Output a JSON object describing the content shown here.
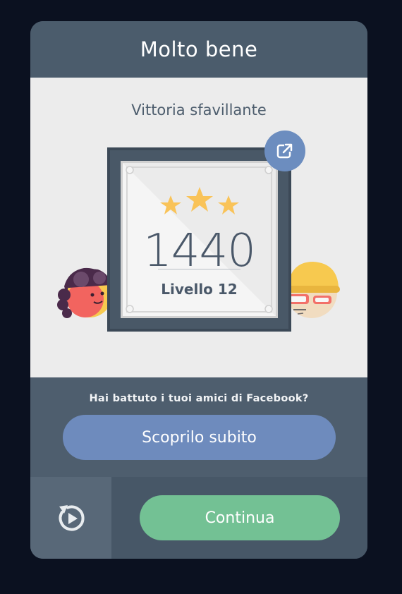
{
  "header": {
    "title": "Molto bene"
  },
  "result": {
    "subtitle": "Vittoria sfavillante",
    "score": "1440",
    "level": "Livello 12",
    "stars_earned": 3,
    "stars_total": 3
  },
  "share": {
    "icon": "share-icon"
  },
  "facebook": {
    "question": "Hai battuto i tuoi amici di Facebook?",
    "button_label": "Scoprilo subito"
  },
  "footer": {
    "replay_icon": "replay-icon",
    "continue_label": "Continua"
  },
  "colors": {
    "background": "#0b1120",
    "header": "#4b5c6c",
    "panel": "#ececec",
    "frame": "#495867",
    "star": "#f9c358",
    "share_button": "#6c8dbf",
    "facebook_button": "#6e8bbd",
    "continue_button": "#73c194",
    "replay_panel": "#586878"
  }
}
